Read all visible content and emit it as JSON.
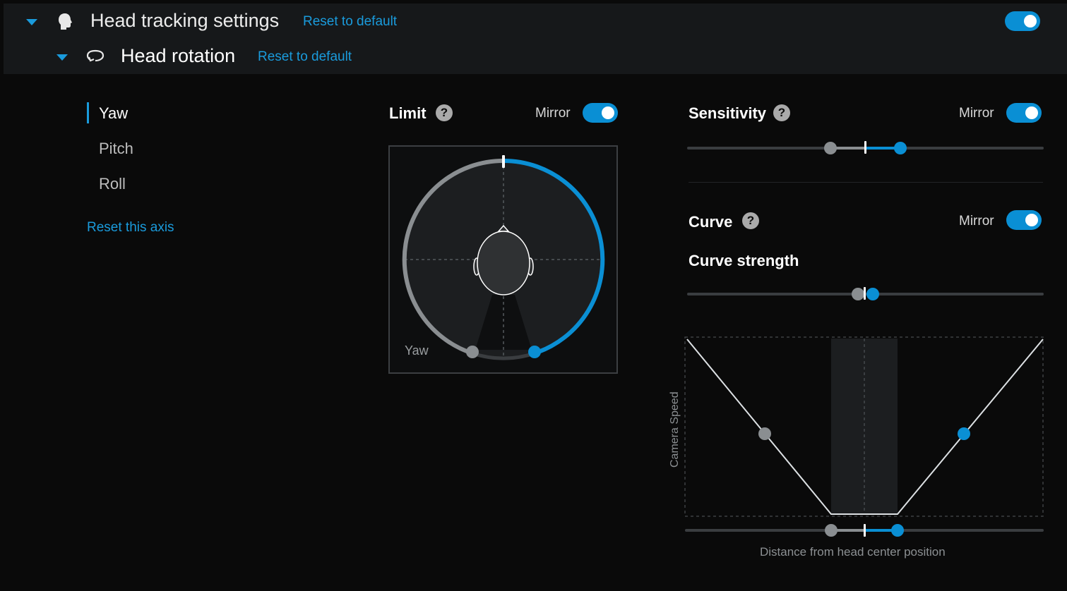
{
  "header": {
    "title": "Head tracking settings",
    "reset_label": "Reset to default",
    "enabled": true,
    "icons": {
      "collapse": "chevron-down-icon",
      "head": "head-icon"
    }
  },
  "subheader": {
    "title": "Head rotation",
    "reset_label": "Reset to default",
    "icons": {
      "collapse": "chevron-down-icon",
      "rotation": "rotate-icon"
    }
  },
  "axes": {
    "items": [
      {
        "label": "Yaw",
        "active": true
      },
      {
        "label": "Pitch",
        "active": false
      },
      {
        "label": "Roll",
        "active": false
      }
    ],
    "reset_label": "Reset this axis"
  },
  "limit": {
    "title": "Limit",
    "help": "?",
    "mirror_label": "Mirror",
    "mirror_on": true,
    "dial_label": "Yaw"
  },
  "sensitivity": {
    "title": "Sensitivity",
    "help": "?",
    "mirror_label": "Mirror",
    "mirror_on": true
  },
  "curve": {
    "title": "Curve",
    "help": "?",
    "mirror_label": "Mirror",
    "mirror_on": true,
    "strength_label": "Curve strength",
    "y_axis_label": "Camera Speed",
    "x_axis_label": "Distance from head center position"
  },
  "colors": {
    "accent": "#0a8fd4",
    "link": "#1a9bdc",
    "inactive": "#8a8e91",
    "background": "#0a0a0a"
  }
}
